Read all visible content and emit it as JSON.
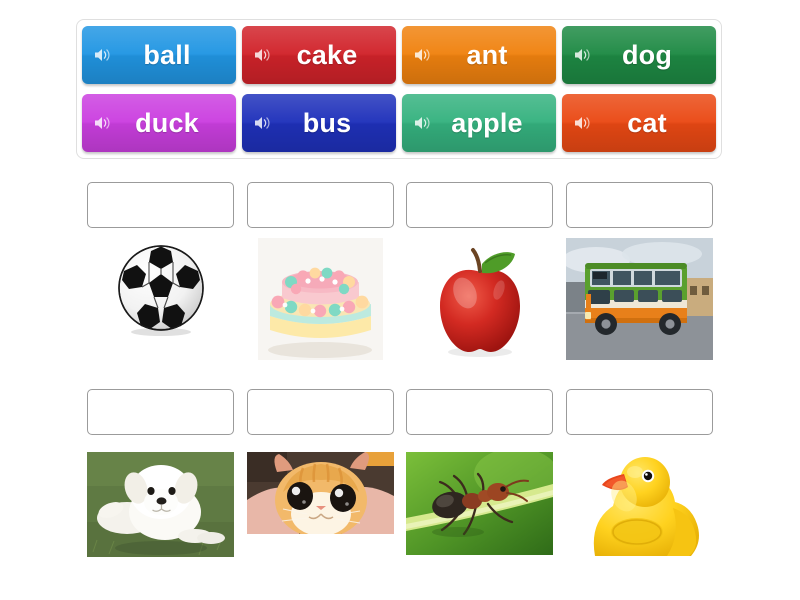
{
  "activity": {
    "type": "match-word-to-picture",
    "background_color": "#ffffff"
  },
  "tile_bank": {
    "border_color": "#dfdfdf",
    "rows": [
      [
        {
          "label": "ball",
          "color": "#2196e3",
          "icon": "speaker-icon"
        },
        {
          "label": "cake",
          "color": "#d1232a",
          "icon": "speaker-icon"
        },
        {
          "label": "ant",
          "color": "#f0820f",
          "icon": "speaker-icon"
        },
        {
          "label": "dog",
          "color": "#1e8a44",
          "icon": "speaker-icon"
        }
      ],
      [
        {
          "label": "duck",
          "color": "#cb3fe0",
          "icon": "speaker-icon"
        },
        {
          "label": "bus",
          "color": "#1f31bb",
          "icon": "speaker-icon"
        },
        {
          "label": "apple",
          "color": "#35b27f",
          "icon": "speaker-icon"
        },
        {
          "label": "cat",
          "color": "#ea4914",
          "icon": "speaker-icon"
        }
      ]
    ]
  },
  "answer_groups": [
    {
      "slots": [
        {
          "value": "",
          "placeholder": ""
        },
        {
          "value": "",
          "placeholder": ""
        },
        {
          "value": "",
          "placeholder": ""
        },
        {
          "value": "",
          "placeholder": ""
        }
      ],
      "pictures": [
        {
          "name": "soccer-ball",
          "alt": "soccer ball"
        },
        {
          "name": "layer-cake",
          "alt": "pastel tiered cake"
        },
        {
          "name": "red-apple",
          "alt": "red apple with leaf"
        },
        {
          "name": "double-decker-bus",
          "alt": "green and orange double decker bus"
        }
      ]
    },
    {
      "slots": [
        {
          "value": "",
          "placeholder": ""
        },
        {
          "value": "",
          "placeholder": ""
        },
        {
          "value": "",
          "placeholder": ""
        },
        {
          "value": "",
          "placeholder": ""
        }
      ],
      "pictures": [
        {
          "name": "white-puppy",
          "alt": "white fluffy puppy on grass"
        },
        {
          "name": "ginger-kitten",
          "alt": "ginger kitten close up"
        },
        {
          "name": "ant-on-grass",
          "alt": "ant on green grass blade"
        },
        {
          "name": "rubber-duck",
          "alt": "yellow rubber duck"
        }
      ]
    }
  ]
}
